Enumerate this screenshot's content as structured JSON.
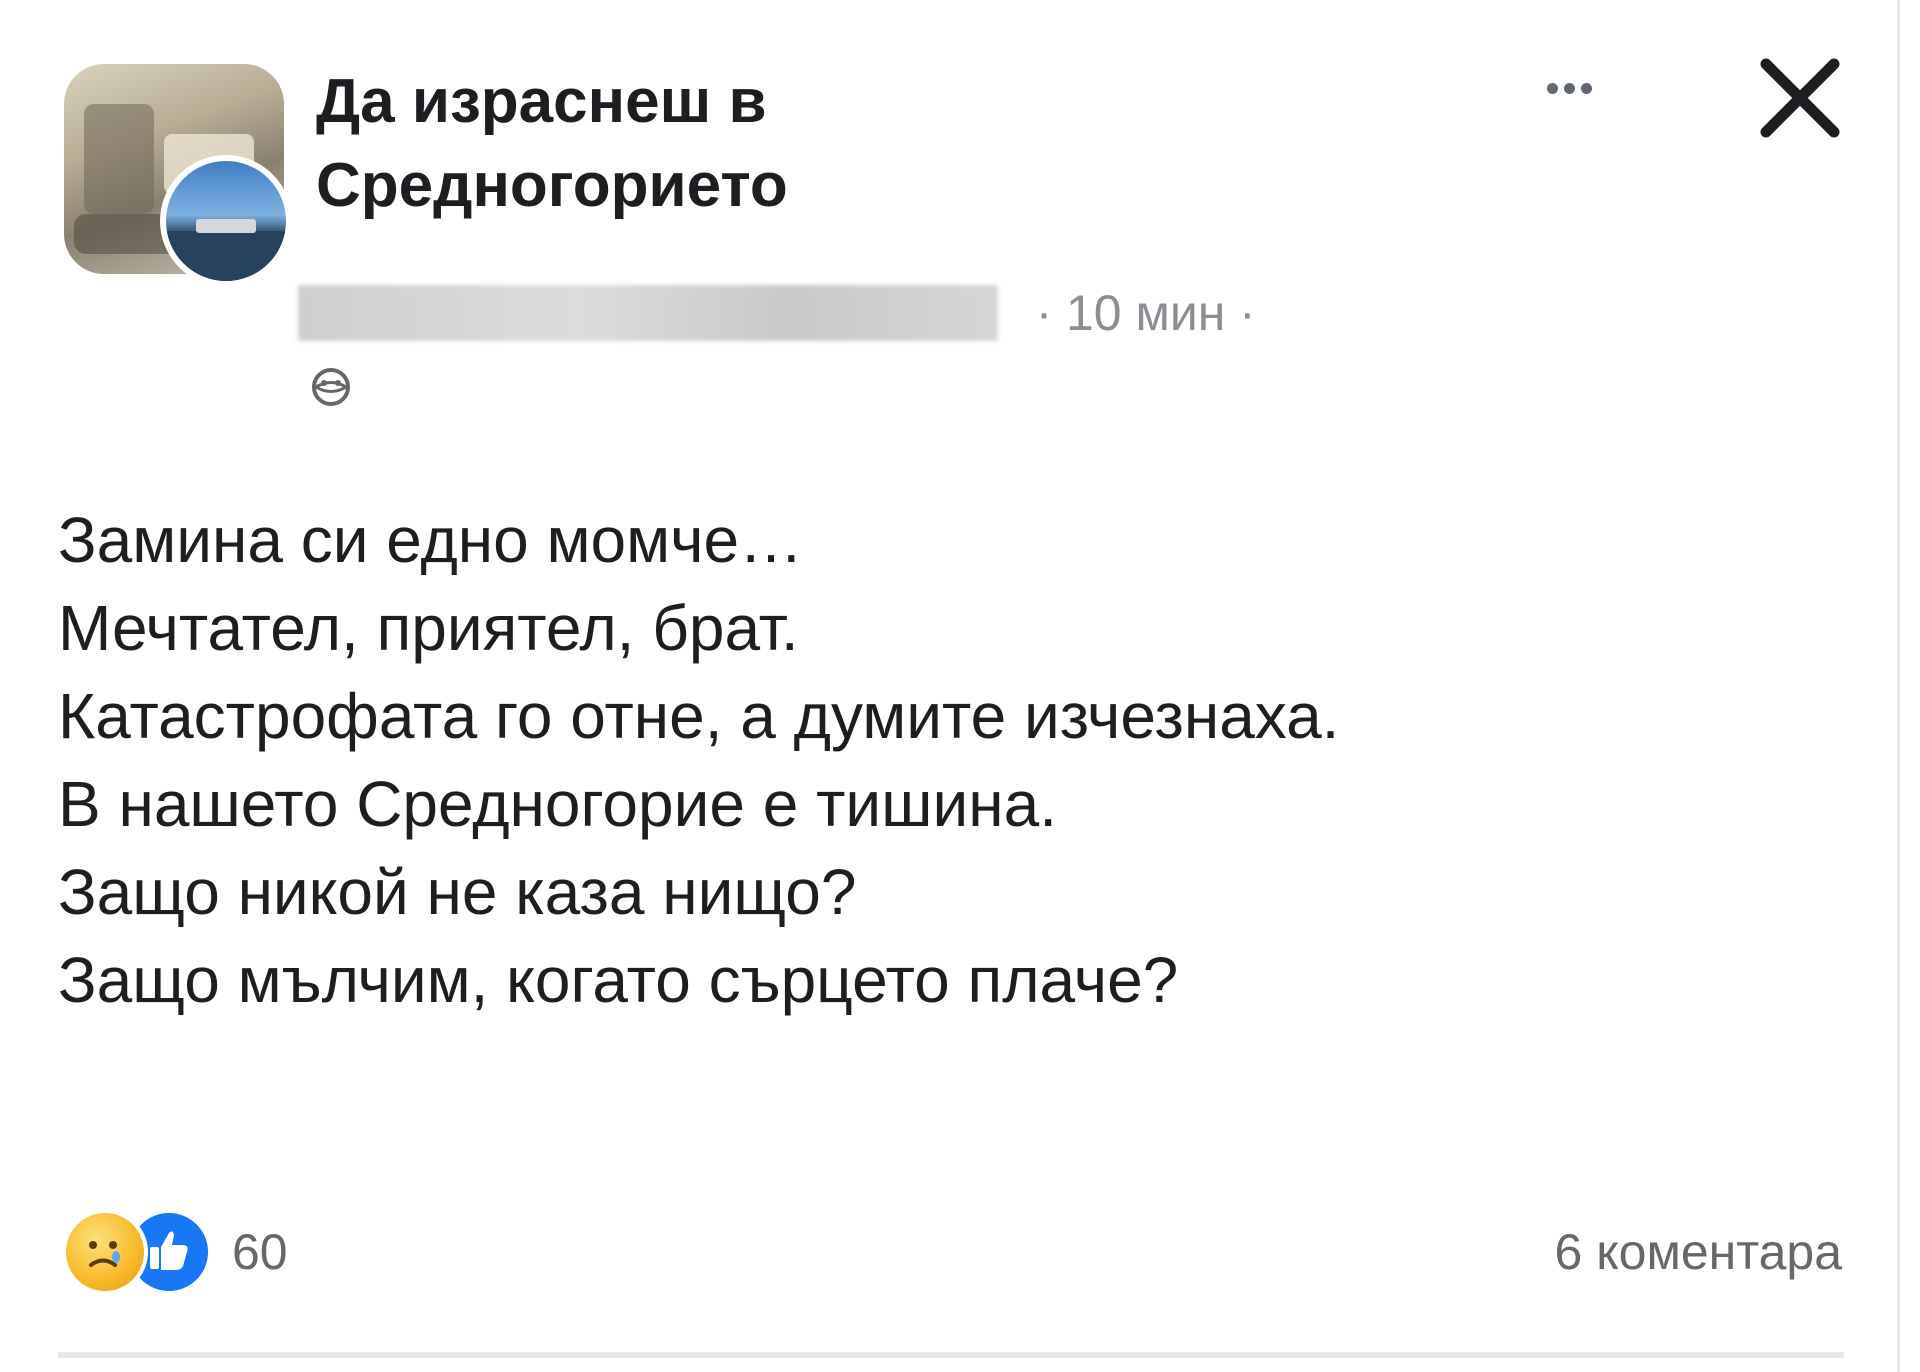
{
  "post": {
    "group_name": "Да израснеш в Средногорието",
    "group_name_line1": "Да израснеш в",
    "group_name_line2": "Средногорието",
    "meta": {
      "separator": "·",
      "time": "10 мин"
    },
    "body_lines": [
      "Замина си едно момче…",
      "Мечтател, приятел, брат.",
      "Катастрофата го отне, а думите изчезнаха.",
      "В нашето Средногорие е тишина.",
      "Защо никой не каза нищо?",
      "Защо мълчим, когато сърцето плаче?"
    ],
    "footer": {
      "reactions": [
        "sad-care-reaction",
        "like-reaction"
      ],
      "reaction_count": "60",
      "comments": "6 коментара"
    }
  },
  "icons": {
    "more": "more-options-icon",
    "close": "close-icon",
    "privacy": "globe-privacy-icon"
  },
  "colors": {
    "like_blue": "#1877f2",
    "reaction_yellow": "#f7b928",
    "secondary_text": "#65676b"
  }
}
